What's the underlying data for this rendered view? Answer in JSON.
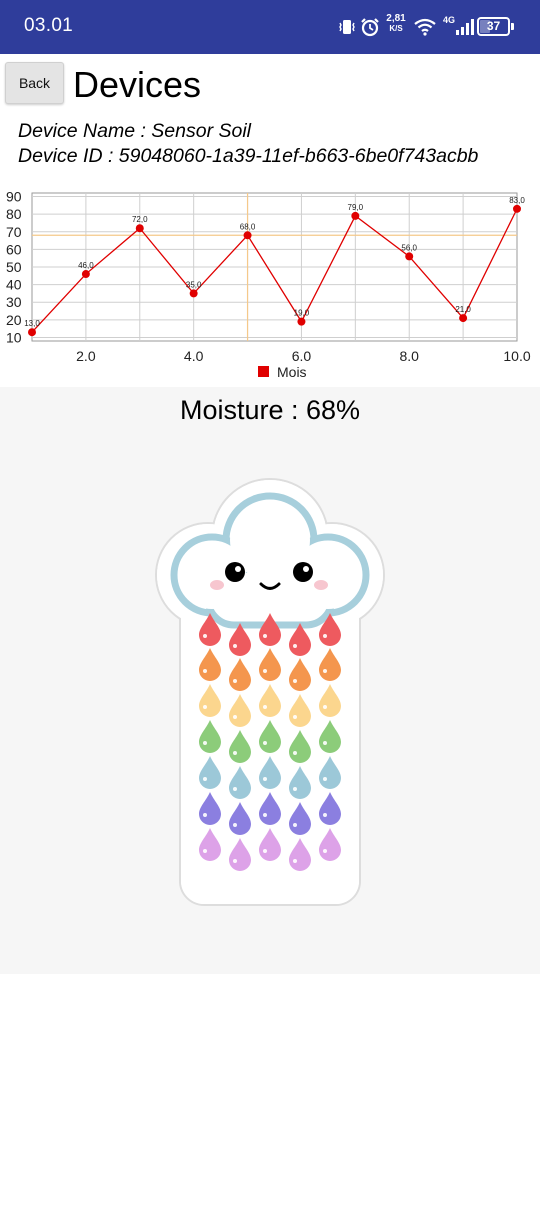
{
  "status_bar": {
    "time": "03.01",
    "net_speed": "2,81",
    "net_unit": "K/S",
    "network": "4G",
    "battery": "37",
    "battery_level": 0.37,
    "icons": [
      "vibrate-icon",
      "alarm-icon",
      "wifi-icon",
      "signal-icon",
      "battery-icon"
    ]
  },
  "header": {
    "back_label": "Back",
    "title": "Devices"
  },
  "device": {
    "name_line": "Device Name : Sensor Soil",
    "id_line": "Device ID : 59048060-1a39-11ef-b663-6be0f743acbb"
  },
  "chart_data": {
    "type": "line",
    "x": [
      1,
      2,
      3,
      4,
      5,
      6,
      7,
      8,
      9,
      10
    ],
    "series": [
      {
        "name": "Mois",
        "values": [
          13,
          46,
          72,
          35,
          68,
          19,
          79,
          56,
          21,
          83
        ],
        "point_labels": [
          "13,0",
          "46,0",
          "72,0",
          "35,0",
          "68,0",
          "19,0",
          "79,0",
          "56,0",
          "21,0",
          "83,0"
        ],
        "color": "#e00000"
      }
    ],
    "xlim": [
      1,
      10
    ],
    "ylim": [
      8,
      92
    ],
    "x_tick_labels": [
      "2.0",
      "4.0",
      "6.0",
      "8.0",
      "10.0"
    ],
    "x_ticks": [
      2,
      4,
      6,
      8,
      10
    ],
    "y_tick_labels": [
      "10",
      "20",
      "30",
      "40",
      "50",
      "60",
      "70",
      "80",
      "90"
    ],
    "y_ticks": [
      10,
      20,
      30,
      40,
      50,
      60,
      70,
      80,
      90
    ],
    "grid": true,
    "highlight": {
      "x": 5,
      "y": 68,
      "color": "#f5c98a"
    },
    "legend": "bottom-center"
  },
  "moisture": {
    "label": "Moisture : 68%",
    "illustration_icon": "rain-cloud-illustration"
  }
}
